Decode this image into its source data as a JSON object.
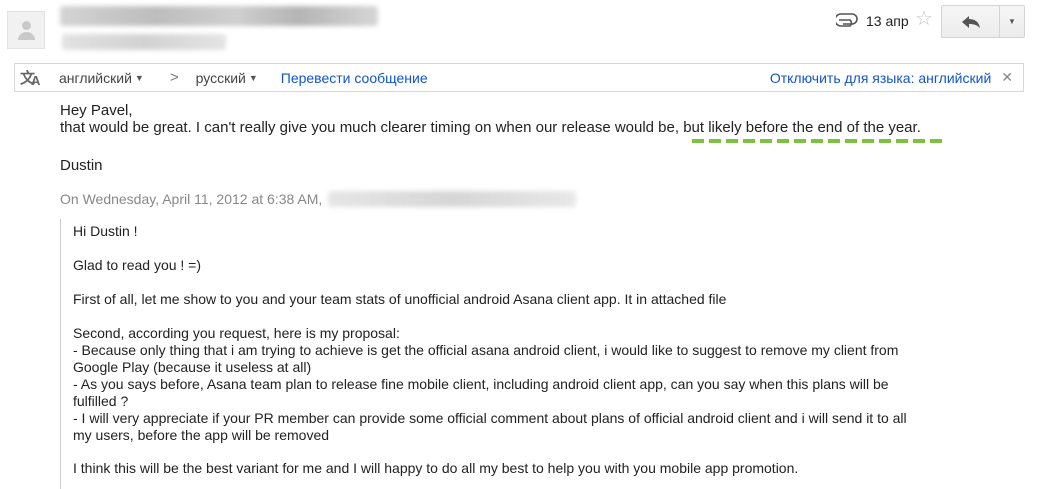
{
  "header": {
    "date": "13 апр",
    "icons": [
      "avatar",
      "paperclip-icon",
      "star-icon",
      "reply-icon",
      "chevron-down-icon"
    ]
  },
  "translate_bar": {
    "source_lang": "английский",
    "target_lang": "русский",
    "translate_link": "Перевести сообщение",
    "disable_link": "Отключить для языка: английский",
    "icons": [
      "translate-icon",
      "chevron-right-icon",
      "close-icon"
    ]
  },
  "message": {
    "greeting": "Hey Pavel,",
    "line1": "that would be great. I can't really give you much clearer timing on when our release would be, but likely before the end of the year.",
    "signature": "Dustin",
    "quote_header": "On Wednesday, April 11, 2012 at 6:38 AM,"
  },
  "quote": {
    "lines": [
      "Hi Dustin !",
      "Glad to read you ! =)",
      "First of all, let me show to you and your team stats of unofficial android Asana client app. It in attached file",
      "Second, according you request, here is  my proposal:",
      "- Because only thing that i am trying to achieve is get the official asana android client, i would like to suggest to remove my client from",
      "Google Play (because it useless at all)",
      "- As you says before, Asana team plan to release fine mobile client, including android client app, can you say when this plans will be",
      "fulfilled ?",
      "- I will very appreciate if your PR member can provide some official comment about plans of official android client and i will send it to all",
      "my users, before the app will be removed",
      "I think this will be the best variant for me and I will happy to do all my best to help you with you mobile app promotion."
    ]
  },
  "colors": {
    "link": "#1155cc",
    "muted": "#888888",
    "squiggle": "#7dc142"
  }
}
